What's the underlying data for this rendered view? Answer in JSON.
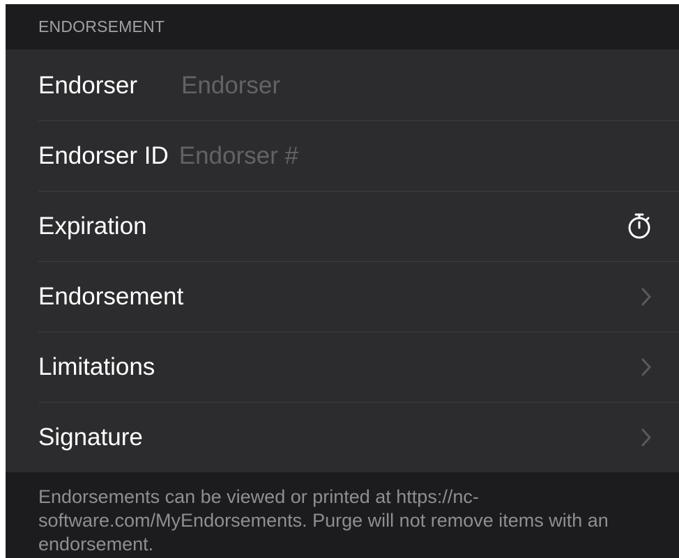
{
  "section": {
    "header": "ENDORSEMENT"
  },
  "rows": {
    "endorser": {
      "label": "Endorser",
      "value": "",
      "placeholder": "Endorser"
    },
    "endorser_id": {
      "label": "Endorser ID",
      "value": "",
      "placeholder": "Endorser #"
    },
    "expiration": {
      "label": "Expiration",
      "icon": "stopwatch-icon"
    },
    "endorsement": {
      "label": "Endorsement",
      "icon": "chevron-right-icon"
    },
    "limitations": {
      "label": "Limitations",
      "icon": "chevron-right-icon"
    },
    "signature": {
      "label": "Signature",
      "icon": "chevron-right-icon"
    }
  },
  "footer": {
    "text": "Endorsements can be viewed or printed at https://nc-software.com/MyEndorsements. Purge will not remove items with an endorsement."
  },
  "colors": {
    "background": "#1c1c1e",
    "cell": "#2c2c2e",
    "label": "#ffffff",
    "placeholder": "#636366",
    "secondary_text": "#8e8e93",
    "chevron": "#5a5a5e"
  }
}
